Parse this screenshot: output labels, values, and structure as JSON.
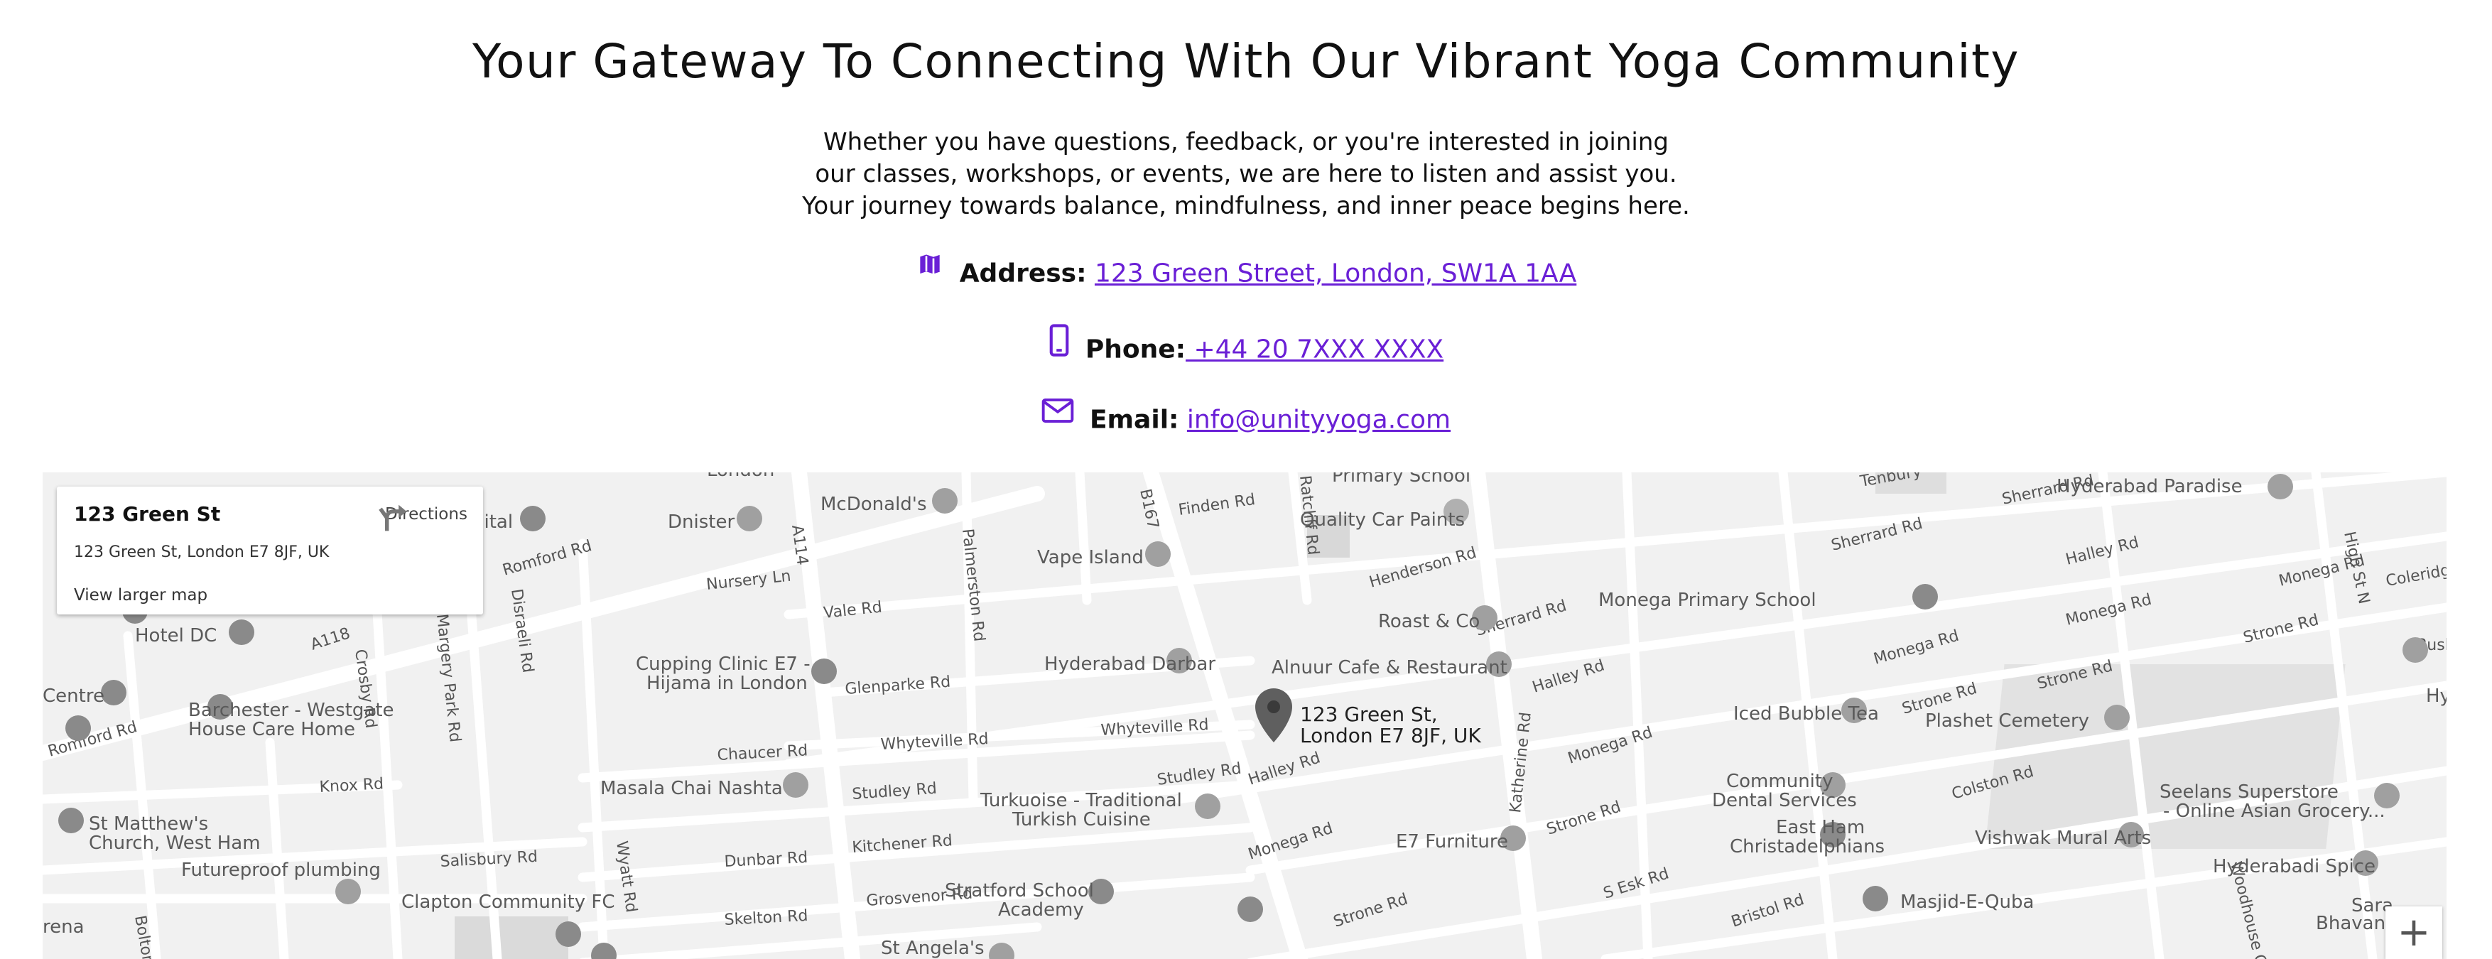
{
  "page": {
    "title": "Your Gateway To Connecting With Our Vibrant Yoga Community",
    "intro_lines": [
      "Whether you have questions, feedback, or you're interested in joining",
      "our classes, workshops, or events, we are here to listen and assist you.",
      "Your journey towards balance, mindfulness, and inner peace begins here."
    ]
  },
  "contact": {
    "address": {
      "icon": "map-icon",
      "label": "Address:",
      "value": "123 Green Street, London, SW1A 1AA"
    },
    "phone": {
      "icon": "phone-icon",
      "label": "Phone:",
      "value": " +44 20 7XXX XXXX"
    },
    "email": {
      "icon": "mail-icon",
      "label": "Email:",
      "value": "info@unityyoga.com"
    },
    "accent_color": "#6a1fd6"
  },
  "map": {
    "info_card": {
      "name": "123 Green St",
      "address": "123 Green St, London E7 8JF, UK",
      "directions_label": "Directions",
      "view_larger_label": "View larger map"
    },
    "marker_label": [
      "123 Green St,",
      "London E7 8JF, UK"
    ],
    "zoom_in_label": "+",
    "streets": [
      "Romford Rd",
      "A114",
      "A118",
      "B167",
      "Finden Rd",
      "Henderson Rd",
      "Sherrard Rd",
      "Halley Rd",
      "Monega Rd",
      "Strone Rd",
      "Colston Rd",
      "Katherine Rd",
      "Glenparke Rd",
      "Vale Rd",
      "Nursery Ln",
      "Whyteville Rd",
      "Chaucer Rd",
      "Studley Rd",
      "Knox Rd",
      "Kitchener Rd",
      "Dunbar Rd",
      "Grosvenor Rd",
      "Skelton Rd",
      "Salisbury Rd",
      "Wyatt Rd",
      "Disraeli Rd",
      "Crosby Rd",
      "Margery Park Rd",
      "Palmerston Rd",
      "Ratcliff Rd",
      "Bristol Rd",
      "S Esk Rd",
      "High St N",
      "Woodhouse Gr",
      "Tenbury",
      "Coleridg",
      "Rusk",
      "Bolton"
    ],
    "places": [
      "Dnister",
      "McDonald's",
      "Primary School",
      "Quality Car Paints",
      "Hyderabad Paradise",
      "Vape Island",
      "Roast & Co",
      "Monega Primary School",
      "Hotel DC",
      "Hyderabad Darbar",
      "Alnuur Cafe & Restaurant",
      "Cupping Clinic E7 -",
      "Hijama in London",
      "Barchester - Westgate",
      "House Care Home",
      "Iced Bubble Tea",
      "Plashet Cemetery",
      "Masala Chai Nashta",
      "Turkuoise - Traditional",
      "Turkish Cuisine",
      "Community",
      "Dental Services",
      "Seelans Superstore",
      "- Online Asian Grocery...",
      "St Matthew's",
      "Church, West Ham",
      "E7 Furniture",
      "East Ham",
      "Christadelphians",
      "Vishwak Mural Arts",
      "Futureproof plumbing",
      "Hyderabadi Spice",
      "Clapton Community FC",
      "Stratford School",
      "Academy",
      "Masjid-E-Quba",
      "Bhavan East",
      "St Angela's",
      "Centre",
      "Sara",
      "Hy",
      "London",
      "gital",
      "rena"
    ]
  }
}
